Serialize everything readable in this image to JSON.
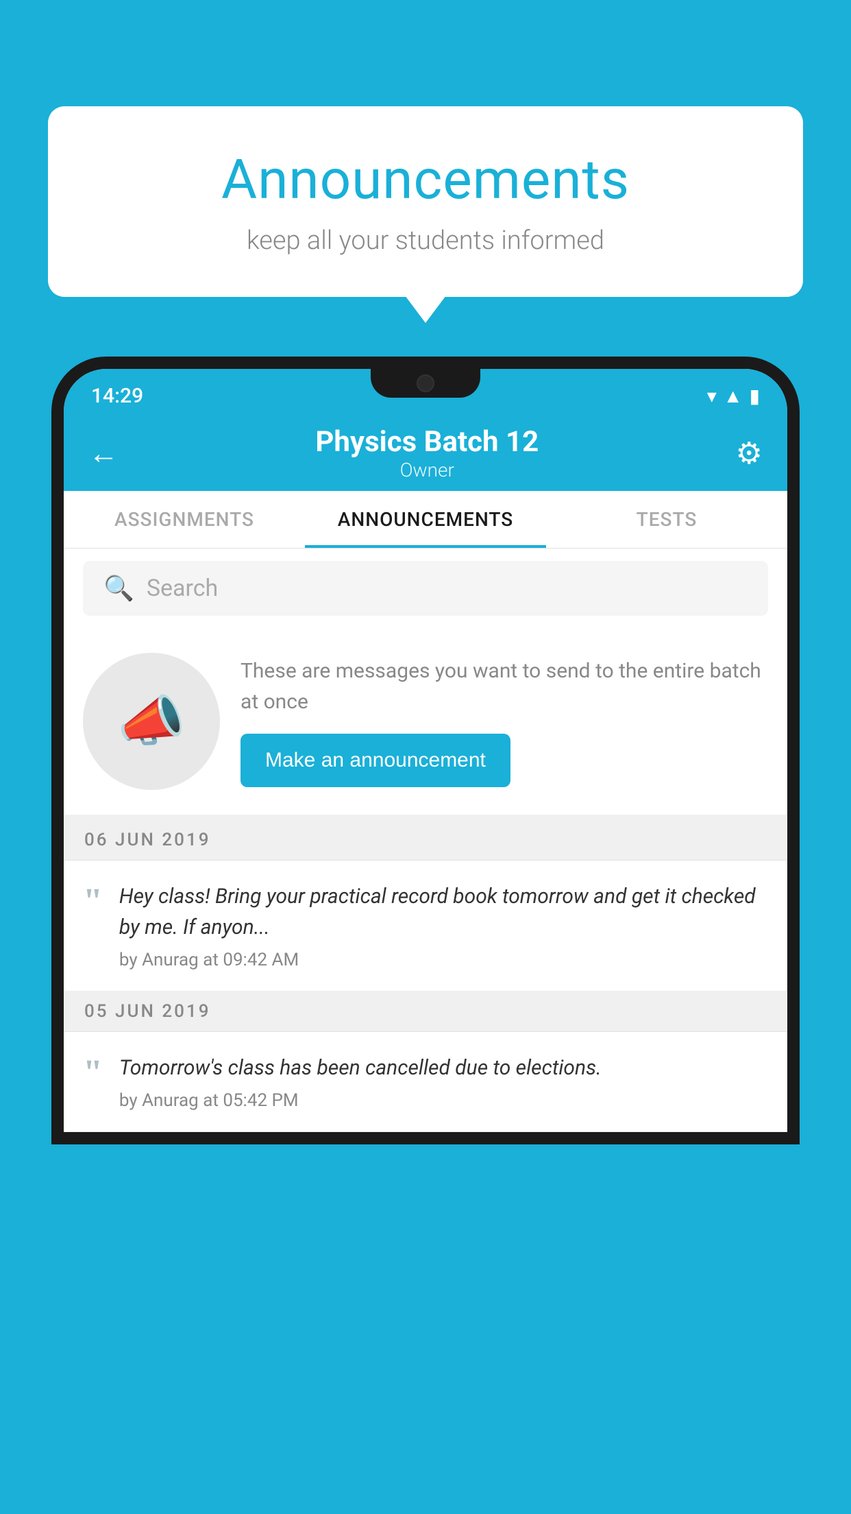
{
  "background_color": "#1ab0d8",
  "speech_bubble": {
    "title": "Announcements",
    "subtitle": "keep all your students informed"
  },
  "status_bar": {
    "time": "14:29",
    "icons": [
      "wifi",
      "signal",
      "battery"
    ]
  },
  "app_bar": {
    "title": "Physics Batch 12",
    "subtitle": "Owner",
    "back_label": "←",
    "settings_label": "⚙"
  },
  "tabs": [
    {
      "label": "ASSIGNMENTS",
      "active": false
    },
    {
      "label": "ANNOUNCEMENTS",
      "active": true
    },
    {
      "label": "TESTS",
      "active": false
    }
  ],
  "search": {
    "placeholder": "Search"
  },
  "promo": {
    "description": "These are messages you want to send to the entire batch at once",
    "button_label": "Make an announcement"
  },
  "announcements": [
    {
      "date": "06  JUN  2019",
      "text": "Hey class! Bring your practical record book tomorrow and get it checked by me. If anyon...",
      "meta": "by Anurag at 09:42 AM"
    },
    {
      "date": "05  JUN  2019",
      "text": "Tomorrow's class has been cancelled due to elections.",
      "meta": "by Anurag at 05:42 PM"
    }
  ]
}
